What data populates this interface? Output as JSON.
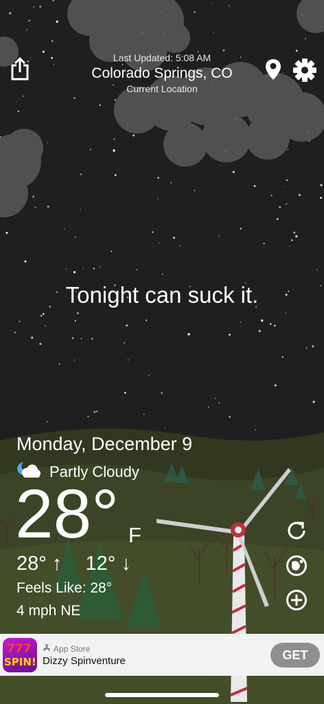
{
  "header": {
    "last_updated": "Last Updated: 5:08 AM",
    "city": "Colorado Springs, CO",
    "current_location": "Current Location"
  },
  "icons": {
    "share": "share-icon",
    "location": "location-pin-icon",
    "settings": "gear-icon",
    "refresh": "refresh-icon",
    "radar": "radar-icon",
    "add": "plus-circle-icon",
    "condition": "partly-cloudy-night-icon"
  },
  "quote": "Tonight can suck it.",
  "weather": {
    "date": "Monday, December 9",
    "condition": "Partly Cloudy",
    "temperature": "28°",
    "unit": "F",
    "high": "28° ↑",
    "low": "12° ↓",
    "feels_like": "Feels Like: 28°",
    "wind": "4 mph NE"
  },
  "ad": {
    "store": "App Store",
    "title": "Dizzy Spinventure",
    "cta": "GET",
    "thumb_top": "777",
    "thumb_bottom": "SPIN!"
  },
  "colors": {
    "sky": "#1f1f1f",
    "hills": "#3b4426",
    "ad_background": "#f2f2f2",
    "get_button": "#8f8f8f"
  }
}
